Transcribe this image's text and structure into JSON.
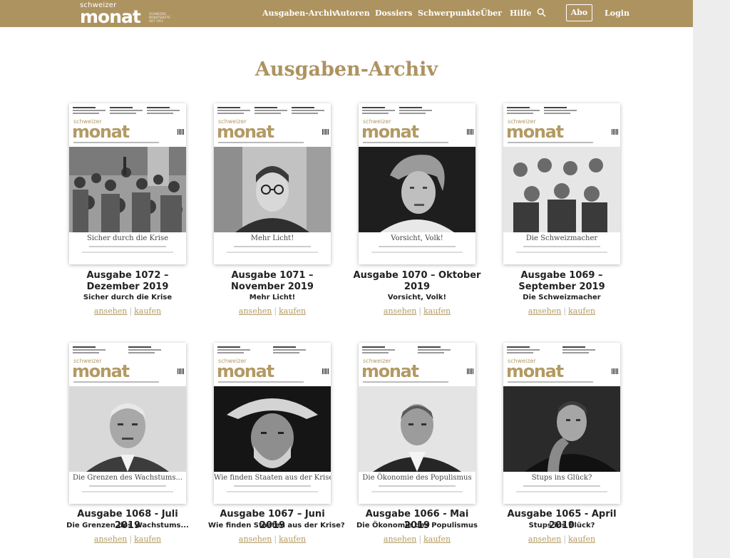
{
  "brand": {
    "small": "schweizer",
    "big": "monat",
    "tiny": [
      "SCHWEIZER",
      "MONATSHEFTE",
      "SEIT 1921"
    ]
  },
  "nav": {
    "items": [
      "Ausgaben-Archiv",
      "Autoren",
      "Dossiers",
      "Schwerpunkte",
      "Über",
      "Hilfe"
    ],
    "search_icon": "search-icon",
    "abo_label": "Abo",
    "login_label": "Login"
  },
  "page_title": "Ausgaben-Archiv",
  "links": {
    "view": "ansehen",
    "buy": "kaufen",
    "separator": "|"
  },
  "issues": [
    {
      "heading": "Ausgabe 1072 – Dezember 2019",
      "title": "Sicher durch die Krise",
      "cover_title": "Sicher durch die Krise",
      "photo": "crowd-protest-illustration"
    },
    {
      "heading": "Ausgabe 1071 – November 2019",
      "title": "Mehr Licht!",
      "cover_title": "Mehr Licht!",
      "photo": "portrait-man-glasses"
    },
    {
      "heading": "Ausgabe 1070 – Oktober 2019",
      "title": "Vorsicht, Volk!",
      "cover_title": "Vorsicht, Volk!",
      "photo": "portrait-older-man"
    },
    {
      "heading": "Ausgabe 1069 – September 2019",
      "title": "Die Schweizmacher",
      "cover_title": "Die Schweizmacher",
      "photo": "group-portrait-engraving"
    },
    {
      "heading": "Ausgabe 1068 - Juli 2019",
      "title": "Die Grenzen des Wachstums...",
      "cover_title": "Die Grenzen des Wachstums...",
      "photo": "portrait-man-suit"
    },
    {
      "heading": "Ausgabe 1067 – Juni 2019",
      "title": "Wie finden Staaten aus der Krise?",
      "cover_title": "Wie finden Staaten aus der Krise?",
      "photo": "portrait-man-hat"
    },
    {
      "heading": "Ausgabe 1066 - Mai 2019",
      "title": "Die Ökonomie des Populismus",
      "cover_title": "Die Ökonomie des Populismus",
      "photo": "portrait-man-jacket"
    },
    {
      "heading": "Ausgabe 1065 - April 2019",
      "title": "Stups ins Glück?",
      "cover_title": "Stups ins Glück?",
      "photo": "portrait-man-thinking"
    }
  ],
  "colors": {
    "brand_gold": "#ad9360",
    "link_gold": "#b39a64",
    "heading": "#222222",
    "background": "#ffffff"
  }
}
